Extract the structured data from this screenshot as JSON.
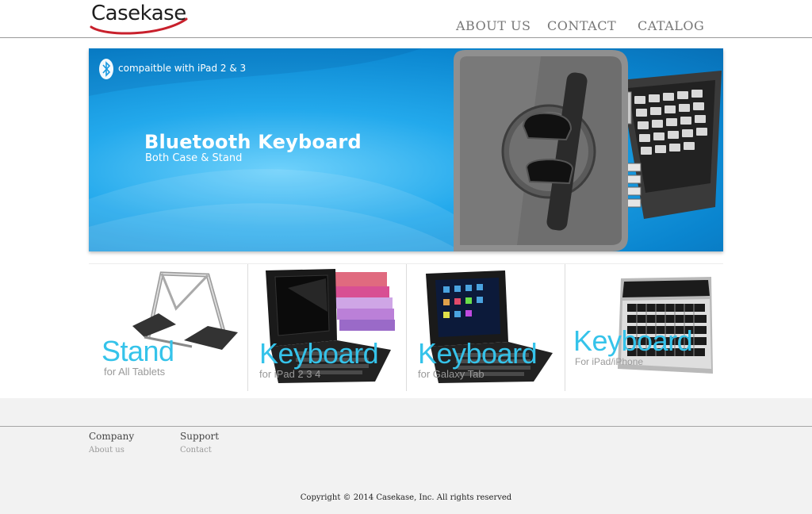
{
  "header": {
    "logo_text": "Casekase",
    "nav": [
      "ABOUT US",
      "CONTACT",
      "CATALOG"
    ]
  },
  "banner": {
    "compat_text": "compaitble with iPad 2 & 3",
    "title": "Bluetooth Keyboard",
    "subtitle": "Both Case & Stand",
    "icons": [
      "bluetooth-icon"
    ]
  },
  "products": [
    {
      "title": "Stand",
      "subtitle": "for All Tablets"
    },
    {
      "title": "Keyboard",
      "subtitle": "for iPad 2 3 4"
    },
    {
      "title": "Keyboard",
      "subtitle": "for Galaxy Tab"
    },
    {
      "title": "Keyboard",
      "subtitle": "For iPad/iPhone"
    }
  ],
  "footer": {
    "columns": [
      {
        "title": "Company",
        "link": "About us"
      },
      {
        "title": "Support",
        "link": "Contact"
      }
    ],
    "copyright": "Copyright © 2014 Casekase, Inc. All rights reserved"
  },
  "colors": {
    "accent_blue": "#35c3ea",
    "banner_blue": "#1a9ae0",
    "logo_red": "#c8202c"
  }
}
